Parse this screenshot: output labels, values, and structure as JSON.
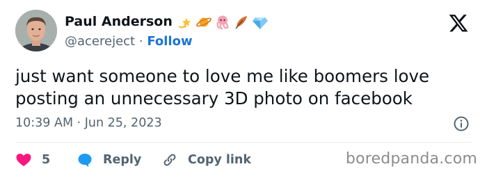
{
  "author": {
    "name": "Paul Anderson",
    "handle": "@acereject",
    "separator": "·",
    "follow_label": "Follow",
    "badges": [
      "dizzy-star-icon",
      "ringed-planet-icon",
      "octopus-icon",
      "feather-icon",
      "gem-icon"
    ]
  },
  "tweet": {
    "text": "just want someone to love me like boomers love posting an unnecessary 3D photo on facebook",
    "timestamp": "10:39 AM · Jun 25, 2023"
  },
  "actions": {
    "like_count": "5",
    "reply_label": "Reply",
    "copy_label": "Copy link"
  },
  "watermark": "boredpanda.com",
  "colors": {
    "link_blue": "#1d74d1",
    "secondary_text": "#536471",
    "like_red": "#f91880",
    "reply_blue": "#1d9bf0",
    "watermark_gray": "#8c8c8c"
  }
}
